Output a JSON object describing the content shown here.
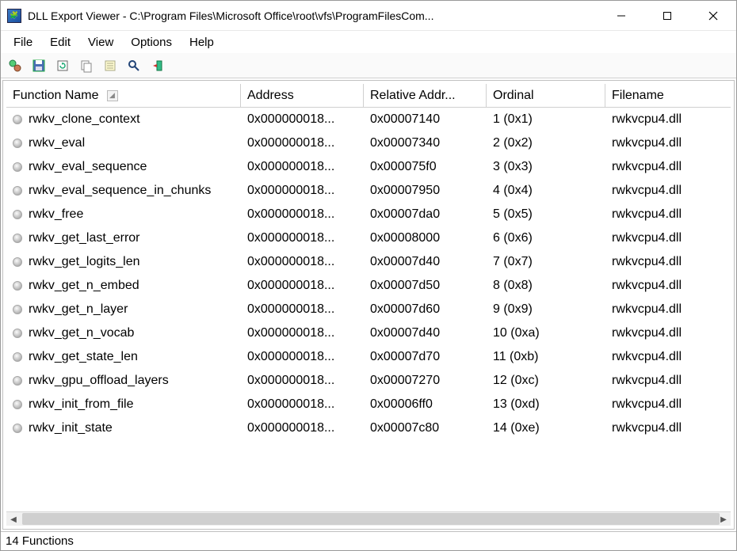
{
  "window": {
    "app_name": "DLL Export Viewer",
    "separator": "  -  ",
    "path": "C:\\Program Files\\Microsoft Office\\root\\vfs\\ProgramFilesCom..."
  },
  "menu": {
    "file": "File",
    "edit": "Edit",
    "view": "View",
    "options": "Options",
    "help": "Help"
  },
  "toolbar": {
    "icons": [
      "settings-gears",
      "save-disk",
      "refresh",
      "copy",
      "properties",
      "find",
      "exit"
    ]
  },
  "columns": {
    "function_name": "Function Name",
    "address": "Address",
    "relative_address": "Relative Addr...",
    "ordinal": "Ordinal",
    "filename": "Filename"
  },
  "rows": [
    {
      "fn": "rwkv_clone_context",
      "addr": "0x000000018...",
      "reladdr": "0x00007140",
      "ord": "1 (0x1)",
      "file": "rwkvcpu4.dll"
    },
    {
      "fn": "rwkv_eval",
      "addr": "0x000000018...",
      "reladdr": "0x00007340",
      "ord": "2 (0x2)",
      "file": "rwkvcpu4.dll"
    },
    {
      "fn": "rwkv_eval_sequence",
      "addr": "0x000000018...",
      "reladdr": "0x000075f0",
      "ord": "3 (0x3)",
      "file": "rwkvcpu4.dll"
    },
    {
      "fn": "rwkv_eval_sequence_in_chunks",
      "addr": "0x000000018...",
      "reladdr": "0x00007950",
      "ord": "4 (0x4)",
      "file": "rwkvcpu4.dll"
    },
    {
      "fn": "rwkv_free",
      "addr": "0x000000018...",
      "reladdr": "0x00007da0",
      "ord": "5 (0x5)",
      "file": "rwkvcpu4.dll"
    },
    {
      "fn": "rwkv_get_last_error",
      "addr": "0x000000018...",
      "reladdr": "0x00008000",
      "ord": "6 (0x6)",
      "file": "rwkvcpu4.dll"
    },
    {
      "fn": "rwkv_get_logits_len",
      "addr": "0x000000018...",
      "reladdr": "0x00007d40",
      "ord": "7 (0x7)",
      "file": "rwkvcpu4.dll"
    },
    {
      "fn": "rwkv_get_n_embed",
      "addr": "0x000000018...",
      "reladdr": "0x00007d50",
      "ord": "8 (0x8)",
      "file": "rwkvcpu4.dll"
    },
    {
      "fn": "rwkv_get_n_layer",
      "addr": "0x000000018...",
      "reladdr": "0x00007d60",
      "ord": "9 (0x9)",
      "file": "rwkvcpu4.dll"
    },
    {
      "fn": "rwkv_get_n_vocab",
      "addr": "0x000000018...",
      "reladdr": "0x00007d40",
      "ord": "10 (0xa)",
      "file": "rwkvcpu4.dll"
    },
    {
      "fn": "rwkv_get_state_len",
      "addr": "0x000000018...",
      "reladdr": "0x00007d70",
      "ord": "11 (0xb)",
      "file": "rwkvcpu4.dll"
    },
    {
      "fn": "rwkv_gpu_offload_layers",
      "addr": "0x000000018...",
      "reladdr": "0x00007270",
      "ord": "12 (0xc)",
      "file": "rwkvcpu4.dll"
    },
    {
      "fn": "rwkv_init_from_file",
      "addr": "0x000000018...",
      "reladdr": "0x00006ff0",
      "ord": "13 (0xd)",
      "file": "rwkvcpu4.dll"
    },
    {
      "fn": "rwkv_init_state",
      "addr": "0x000000018...",
      "reladdr": "0x00007c80",
      "ord": "14 (0xe)",
      "file": "rwkvcpu4.dll"
    }
  ],
  "status": {
    "text": "14 Functions"
  }
}
